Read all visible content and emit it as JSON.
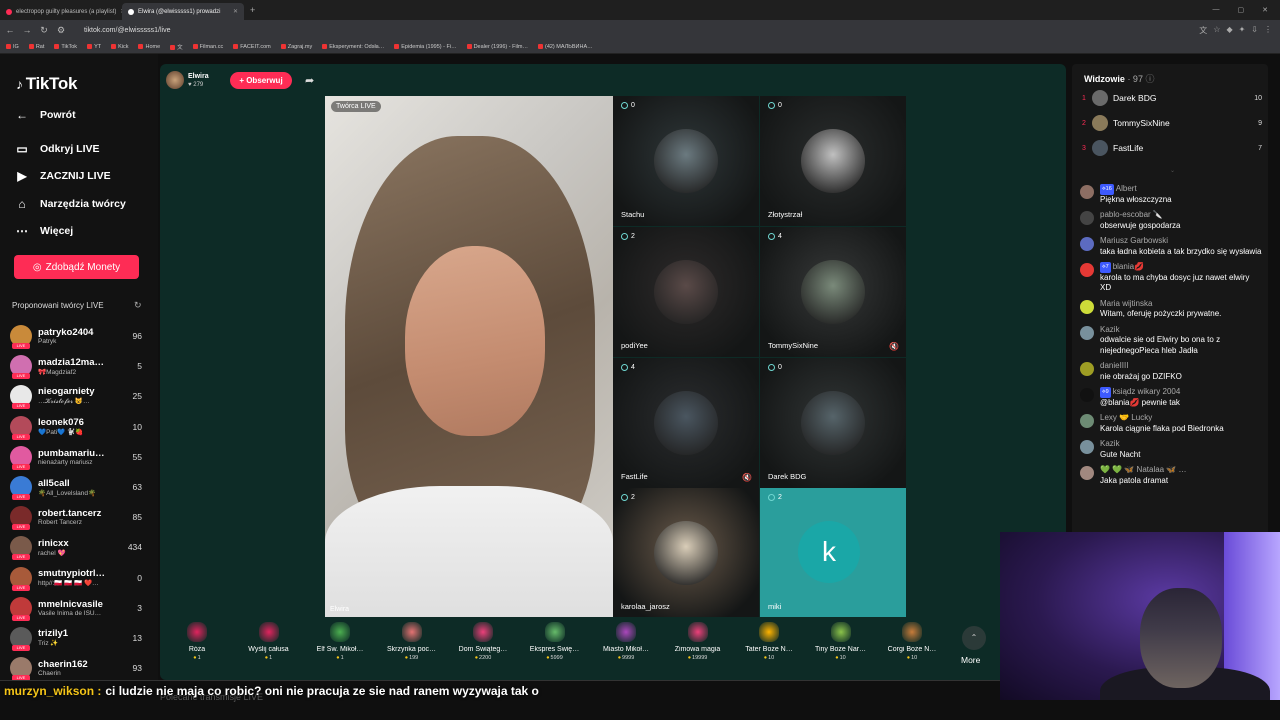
{
  "browser": {
    "tabs": [
      {
        "title": "electropop guilty pleasures (a playlist)"
      },
      {
        "title": "Elwira (@elwisssss1) prowadzi"
      }
    ],
    "url": "tiktok.com/@elwisssss1/live",
    "bookmarks": [
      "IG",
      "Rat",
      "TikTok",
      "YT",
      "Kick",
      "Home",
      "文",
      "Filman.cc",
      "FACEIT.com",
      "Zagraj.my",
      "Eksperyment: Odsła…",
      "Epidemia (1995) - Fi…",
      "Dealer (1996) - Film…",
      "(42) МАЛЬВИНА…"
    ]
  },
  "sidebar": {
    "logo": "TikTok",
    "menu": [
      {
        "label": "Powrót"
      },
      {
        "label": "Odkryj LIVE"
      },
      {
        "label": "ZACZNIJ LIVE"
      },
      {
        "label": "Narzędzia twórcy"
      },
      {
        "label": "Więcej"
      }
    ],
    "coins_button": "Zdobądź Monety",
    "suggested_title": "Proponowani twórcy LIVE",
    "creators": [
      {
        "name": "patryko2404",
        "sub": "Patryk",
        "count": "96",
        "color": "#c98a3a"
      },
      {
        "name": "madzia12ma…",
        "sub": "🎀Magdziaf2",
        "count": "5",
        "color": "#d06fb0"
      },
      {
        "name": "nieogarniety",
        "sub": "…𝓚𝓻𝓲𝓼𝓽𝓸𝓯𝓮𝓻 😺…",
        "count": "25",
        "color": "#e8e8e8"
      },
      {
        "name": "leonek076",
        "sub": "💙Pati💙 🐩🍓",
        "count": "10",
        "color": "#b34a5a"
      },
      {
        "name": "pumbamariu…",
        "sub": "nienażarty mariusz",
        "count": "55",
        "color": "#e15aa0"
      },
      {
        "name": "all5call",
        "sub": "🌴All_Lovelsland🌴",
        "count": "63",
        "color": "#3a7bd5"
      },
      {
        "name": "robert.tancerz",
        "sub": "Robert Tancerz",
        "count": "85",
        "color": "#7a2a2a"
      },
      {
        "name": "rinicxx",
        "sub": "rachel 💖",
        "count": "434",
        "color": "#7a5a4a"
      },
      {
        "name": "smutnypiotrl…",
        "sub": "http//:🇵🇱 🇵🇱 🇵🇱 ❤️…",
        "count": "0",
        "color": "#a85a3a"
      },
      {
        "name": "mmelnicvasile",
        "sub": "Vasile Inima de ISU…",
        "count": "3",
        "color": "#c03a3a"
      },
      {
        "name": "trizily1",
        "sub": "Triz ✨",
        "count": "13",
        "color": "#5a5a5a"
      },
      {
        "name": "chaerin162",
        "sub": "Chaerin",
        "count": "93",
        "color": "#9a7a6a"
      }
    ]
  },
  "stream": {
    "host_name": "Elwira",
    "host_likes": "279",
    "follow_label": "+ Obserwuj",
    "creator_badge": "Twórca LIVE",
    "main_name": "Elwira",
    "guests": [
      {
        "name": "Stachu",
        "count": "0",
        "color": "#6b7a80",
        "muted": false
      },
      {
        "name": "Złotystrzał",
        "count": "0",
        "color": "#c0c0c0",
        "muted": false
      },
      {
        "name": "podiYee",
        "count": "2",
        "color": "#5a4a48",
        "muted": false
      },
      {
        "name": "TommySixNine",
        "count": "4",
        "color": "#7a8a7a",
        "muted": true
      },
      {
        "name": "FastLife",
        "count": "4",
        "color": "#4a5660",
        "muted": true
      },
      {
        "name": "Darek BDG",
        "count": "0",
        "color": "#56646a",
        "muted": false
      },
      {
        "name": "karolaa_jarosz",
        "count": "2",
        "color": "#d9cdb8",
        "muted": false
      },
      {
        "name": "miki",
        "count": "2",
        "color": "#1aa7a7",
        "muted": false,
        "letter": "k"
      }
    ]
  },
  "gifts": [
    {
      "name": "Róża",
      "price": "1",
      "color": "#e0245e"
    },
    {
      "name": "Wyślij całusa",
      "price": "1",
      "color": "#e0245e"
    },
    {
      "name": "Elf Św. Mikoł…",
      "price": "1",
      "color": "#4caf50"
    },
    {
      "name": "Skrzynka poc…",
      "price": "199",
      "color": "#e57373"
    },
    {
      "name": "Dom Świąteg…",
      "price": "2200",
      "color": "#ec407a"
    },
    {
      "name": "Ekspres Świę…",
      "price": "5999",
      "color": "#66bb6a"
    },
    {
      "name": "Miasto Mikoł…",
      "price": "9999",
      "color": "#ab47bc"
    },
    {
      "name": "Zimowa magia",
      "price": "19999",
      "color": "#ec407a"
    },
    {
      "name": "Tater Boże N…",
      "price": "10",
      "color": "#ffb300"
    },
    {
      "name": "Tiny Boże Nar…",
      "price": "10",
      "color": "#8bc34a"
    },
    {
      "name": "Corgi Boże N…",
      "price": "10",
      "color": "#c77c3a"
    }
  ],
  "more_label": "More",
  "viewers": {
    "title": "Widzowie",
    "count": "· 97",
    "top": [
      {
        "rank": "1",
        "name": "Darek BDG",
        "score": "10"
      },
      {
        "rank": "2",
        "name": "TommySixNine",
        "score": "9"
      },
      {
        "rank": "3",
        "name": "FastLife",
        "score": "7"
      }
    ]
  },
  "chat": [
    {
      "user": "Albert",
      "level": "16",
      "text": "Piękna włoszczyzna",
      "color": "#8d6e63"
    },
    {
      "user": "pablo-escobar 🔪",
      "level": "",
      "text": "obserwuje gospodarza",
      "color": "#444"
    },
    {
      "user": "Mariusz Garbowski",
      "level": "",
      "text": "taka ładna kobieta a tak brzydko się wysławia",
      "color": "#5c6bc0"
    },
    {
      "user": "blania💋",
      "level": "7",
      "text": "karola to ma chyba dosyc juz nawet elwiry XD",
      "color": "#e53935"
    },
    {
      "user": "Maria wijtinska",
      "level": "",
      "text": "Witam, oferuję pożyczki prywatne.",
      "color": "#cddc39"
    },
    {
      "user": "Kazik",
      "level": "",
      "text": "odwalcie sie od Elwiry bo ona to z niejednegoPieca hleb Jadła",
      "color": "#78909c"
    },
    {
      "user": "danieIIII",
      "level": "",
      "text": "nie obrażaj go DZIFKO",
      "color": "#9e9d24"
    },
    {
      "user": "ksiądz wikary 2004",
      "level": "9",
      "text": "@blania💋 pewnie tak",
      "color": "#111"
    },
    {
      "user": "Lexy 🤝 Lucky",
      "level": "",
      "text": "Karola ciągnie flaka pod Biedronka",
      "color": "#6d8b74"
    },
    {
      "user": "Kazik",
      "level": "",
      "text": "Gute Nacht",
      "color": "#78909c"
    },
    {
      "user": "💚 💚 🦋 Natalaa 🦋 …",
      "level": "",
      "text": "Jaka patola dramat",
      "color": "#a1887f"
    }
  ],
  "overlay": {
    "user": "murzyn_wikson :",
    "text": "ci ludzie nie maja co robic? oni nie pracuja ze sie nad ranem wyzywaja tak o"
  },
  "peek": "Polecane transmisje LIVE"
}
